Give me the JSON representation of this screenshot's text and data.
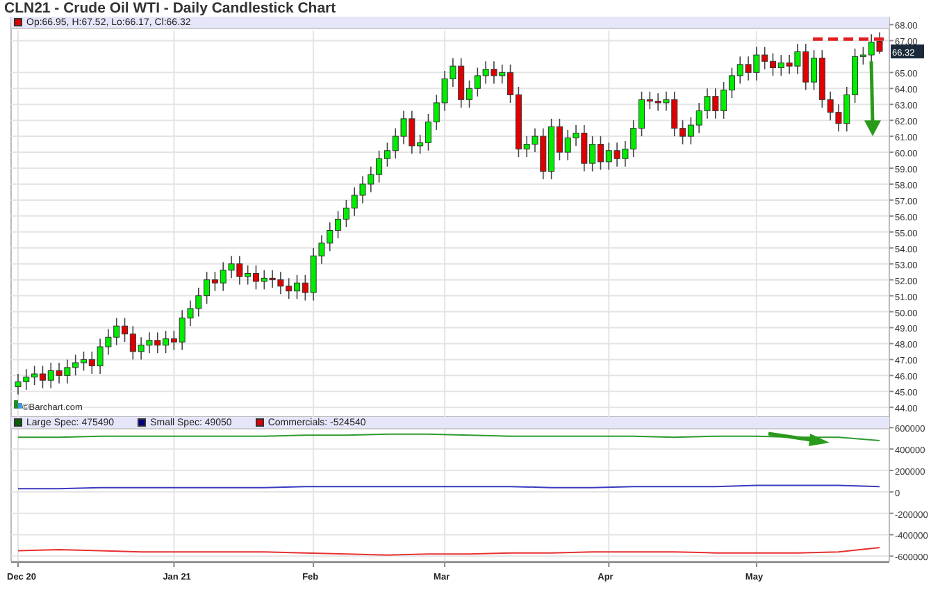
{
  "title": "CLN21 - Crude Oil WTI - Daily Candlestick Chart",
  "price_panel": {
    "legend": "Op:66.95, H:67.52, Lo:66.17, Cl:66.32",
    "last_price": "66.32",
    "credit": "©Barchart.com",
    "chart_data": {
      "type": "candlestick",
      "grid": true,
      "ylim": [
        43.4,
        68.5
      ],
      "yticks": [
        {
          "value": 68,
          "label": "68.00"
        },
        {
          "value": 67,
          "label": "67.00"
        },
        {
          "value": 65,
          "label": "65.00"
        },
        {
          "value": 64,
          "label": "64.00"
        },
        {
          "value": 63,
          "label": "63.00"
        },
        {
          "value": 62,
          "label": "62.00"
        },
        {
          "value": 61,
          "label": "61.00"
        },
        {
          "value": 60,
          "label": "60.00"
        },
        {
          "value": 59,
          "label": "59.00"
        },
        {
          "value": 58,
          "label": "58.00"
        },
        {
          "value": 57,
          "label": "57.00"
        },
        {
          "value": 56,
          "label": "56.00"
        },
        {
          "value": 55,
          "label": "55.00"
        },
        {
          "value": 54,
          "label": "54.00"
        },
        {
          "value": 53,
          "label": "53.00"
        },
        {
          "value": 52,
          "label": "52.00"
        },
        {
          "value": 51,
          "label": "51.00"
        },
        {
          "value": 50,
          "label": "50.00"
        },
        {
          "value": 49,
          "label": "49.00"
        },
        {
          "value": 48,
          "label": "48.00"
        },
        {
          "value": 47,
          "label": "47.00"
        },
        {
          "value": 46,
          "label": "46.00"
        },
        {
          "value": 45,
          "label": "45.00"
        },
        {
          "value": 44,
          "label": "44.00"
        }
      ],
      "ohlc": [
        [
          45.3,
          46.1,
          44.8,
          45.6
        ],
        [
          45.6,
          46.4,
          45.1,
          45.9
        ],
        [
          45.9,
          46.6,
          45.4,
          46.1
        ],
        [
          46.1,
          46.6,
          45.2,
          45.7
        ],
        [
          45.7,
          46.8,
          45.2,
          46.3
        ],
        [
          46.3,
          46.8,
          45.5,
          46.0
        ],
        [
          46.0,
          47.0,
          45.5,
          46.5
        ],
        [
          46.5,
          47.3,
          46.0,
          46.8
        ],
        [
          46.8,
          47.5,
          46.3,
          47.0
        ],
        [
          47.0,
          47.5,
          46.1,
          46.6
        ],
        [
          46.6,
          48.3,
          46.1,
          47.8
        ],
        [
          47.8,
          48.9,
          47.3,
          48.4
        ],
        [
          48.4,
          49.6,
          47.9,
          49.1
        ],
        [
          49.1,
          49.6,
          48.1,
          48.6
        ],
        [
          48.6,
          49.1,
          47.0,
          47.5
        ],
        [
          47.5,
          48.4,
          47.0,
          47.9
        ],
        [
          47.9,
          48.7,
          47.4,
          48.2
        ],
        [
          48.2,
          48.7,
          47.4,
          47.9
        ],
        [
          47.9,
          48.8,
          47.4,
          48.3
        ],
        [
          48.3,
          48.8,
          47.6,
          48.1
        ],
        [
          48.1,
          50.1,
          47.6,
          49.6
        ],
        [
          49.6,
          50.7,
          49.1,
          50.2
        ],
        [
          50.2,
          51.5,
          49.7,
          51.0
        ],
        [
          51.0,
          52.5,
          50.5,
          52.0
        ],
        [
          52.0,
          52.5,
          51.3,
          51.8
        ],
        [
          51.8,
          53.1,
          51.3,
          52.6
        ],
        [
          52.6,
          53.5,
          52.1,
          53.0
        ],
        [
          53.0,
          53.5,
          51.7,
          52.2
        ],
        [
          52.2,
          52.9,
          51.7,
          52.4
        ],
        [
          52.4,
          52.9,
          51.4,
          51.9
        ],
        [
          51.9,
          52.6,
          51.4,
          52.1
        ],
        [
          52.1,
          52.6,
          51.5,
          52.0
        ],
        [
          52.0,
          52.5,
          51.1,
          51.6
        ],
        [
          51.6,
          52.1,
          50.8,
          51.3
        ],
        [
          51.3,
          52.3,
          50.8,
          51.8
        ],
        [
          51.8,
          52.3,
          50.7,
          51.2
        ],
        [
          51.2,
          54.0,
          50.7,
          53.5
        ],
        [
          53.5,
          54.8,
          53.0,
          54.3
        ],
        [
          54.3,
          55.6,
          53.8,
          55.1
        ],
        [
          55.1,
          56.3,
          54.6,
          55.8
        ],
        [
          55.8,
          57.0,
          55.3,
          56.5
        ],
        [
          56.5,
          57.8,
          56.0,
          57.3
        ],
        [
          57.3,
          58.5,
          56.8,
          58.0
        ],
        [
          58.0,
          59.1,
          57.5,
          58.6
        ],
        [
          58.6,
          60.1,
          58.1,
          59.6
        ],
        [
          59.6,
          60.6,
          59.1,
          60.1
        ],
        [
          60.1,
          61.5,
          59.6,
          61.0
        ],
        [
          61.0,
          62.6,
          60.5,
          62.1
        ],
        [
          62.1,
          62.6,
          59.9,
          60.4
        ],
        [
          60.4,
          61.1,
          59.9,
          60.6
        ],
        [
          60.6,
          62.4,
          60.1,
          61.9
        ],
        [
          61.9,
          63.6,
          61.4,
          63.1
        ],
        [
          63.1,
          65.1,
          62.6,
          64.6
        ],
        [
          64.6,
          65.9,
          64.1,
          65.4
        ],
        [
          65.4,
          65.9,
          62.8,
          63.3
        ],
        [
          63.3,
          64.5,
          62.8,
          64.0
        ],
        [
          64.0,
          65.3,
          63.5,
          64.8
        ],
        [
          64.8,
          65.7,
          64.3,
          65.2
        ],
        [
          65.2,
          65.7,
          64.3,
          64.8
        ],
        [
          64.8,
          65.5,
          64.3,
          65.0
        ],
        [
          65.0,
          65.5,
          63.1,
          63.6
        ],
        [
          63.6,
          64.1,
          59.7,
          60.2
        ],
        [
          60.2,
          61.0,
          59.7,
          60.5
        ],
        [
          60.5,
          61.5,
          60.0,
          61.0
        ],
        [
          61.0,
          61.5,
          58.3,
          58.8
        ],
        [
          58.8,
          62.1,
          58.3,
          61.6
        ],
        [
          61.6,
          62.1,
          59.5,
          60.0
        ],
        [
          60.0,
          61.4,
          59.5,
          60.9
        ],
        [
          60.9,
          61.7,
          60.4,
          61.2
        ],
        [
          61.2,
          61.7,
          58.8,
          59.3
        ],
        [
          59.3,
          61.0,
          58.8,
          60.5
        ],
        [
          60.5,
          61.0,
          58.9,
          59.4
        ],
        [
          59.4,
          60.6,
          58.9,
          60.1
        ],
        [
          60.1,
          60.6,
          59.1,
          59.6
        ],
        [
          59.6,
          60.7,
          59.1,
          60.2
        ],
        [
          60.2,
          62.0,
          59.7,
          61.5
        ],
        [
          61.5,
          63.8,
          61.0,
          63.3
        ],
        [
          63.3,
          63.8,
          62.7,
          63.2
        ],
        [
          63.2,
          63.7,
          62.6,
          63.1
        ],
        [
          63.1,
          63.8,
          62.6,
          63.3
        ],
        [
          63.3,
          63.8,
          61.0,
          61.5
        ],
        [
          61.5,
          62.0,
          60.5,
          61.0
        ],
        [
          61.0,
          62.2,
          60.5,
          61.7
        ],
        [
          61.7,
          63.1,
          61.2,
          62.6
        ],
        [
          62.6,
          64.0,
          62.1,
          63.5
        ],
        [
          63.5,
          64.0,
          62.1,
          62.6
        ],
        [
          62.6,
          64.4,
          62.1,
          63.9
        ],
        [
          63.9,
          65.3,
          63.4,
          64.8
        ],
        [
          64.8,
          66.0,
          64.3,
          65.5
        ],
        [
          65.5,
          66.0,
          64.5,
          65.0
        ],
        [
          65.0,
          66.6,
          64.5,
          66.1
        ],
        [
          66.1,
          66.6,
          65.2,
          65.7
        ],
        [
          65.7,
          66.2,
          64.8,
          65.3
        ],
        [
          65.3,
          66.1,
          64.8,
          65.6
        ],
        [
          65.6,
          66.1,
          64.9,
          65.4
        ],
        [
          65.4,
          66.8,
          64.9,
          66.3
        ],
        [
          66.3,
          66.8,
          63.9,
          64.4
        ],
        [
          64.4,
          66.4,
          63.9,
          65.9
        ],
        [
          65.9,
          66.4,
          62.8,
          63.3
        ],
        [
          63.3,
          63.8,
          62.0,
          62.5
        ],
        [
          62.5,
          63.0,
          61.3,
          61.8
        ],
        [
          61.8,
          64.1,
          61.3,
          63.6
        ],
        [
          63.6,
          66.5,
          63.1,
          66.0
        ],
        [
          66.0,
          66.6,
          65.5,
          66.1
        ],
        [
          66.1,
          67.4,
          65.6,
          66.9
        ],
        [
          66.95,
          67.52,
          66.17,
          66.32
        ]
      ]
    }
  },
  "cot_panel": {
    "legend": [
      {
        "label": "Large Spec: 475490",
        "color": "#006400"
      },
      {
        "label": "Small Spec: 49050",
        "color": "#00008b"
      },
      {
        "label": "Commercials: -524540",
        "color": "#dd0000"
      }
    ],
    "chart_data": {
      "type": "line",
      "grid": true,
      "ylim": [
        -650000,
        700000
      ],
      "yticks": [
        600000,
        400000,
        200000,
        0,
        -200000,
        -400000,
        -600000
      ],
      "series": [
        {
          "color": "#2e9a2e",
          "values": [
            510000,
            510000,
            520000,
            520000,
            520000,
            520000,
            520000,
            530000,
            530000,
            540000,
            540000,
            530000,
            520000,
            520000,
            520000,
            520000,
            510000,
            520000,
            520000,
            510000,
            510000,
            480000
          ]
        },
        {
          "color": "#3a3ac0",
          "values": [
            30000,
            30000,
            40000,
            40000,
            40000,
            40000,
            40000,
            50000,
            50000,
            50000,
            50000,
            50000,
            50000,
            40000,
            40000,
            50000,
            50000,
            50000,
            60000,
            60000,
            60000,
            50000
          ]
        },
        {
          "color": "#e83030",
          "values": [
            -550000,
            -540000,
            -550000,
            -560000,
            -560000,
            -560000,
            -560000,
            -570000,
            -580000,
            -590000,
            -580000,
            -580000,
            -570000,
            -570000,
            -560000,
            -560000,
            -560000,
            -570000,
            -570000,
            -570000,
            -560000,
            -520000
          ]
        }
      ]
    }
  },
  "time_axis": [
    "Dec 20",
    "Jan 21",
    "Feb",
    "Mar",
    "Apr",
    "May"
  ]
}
